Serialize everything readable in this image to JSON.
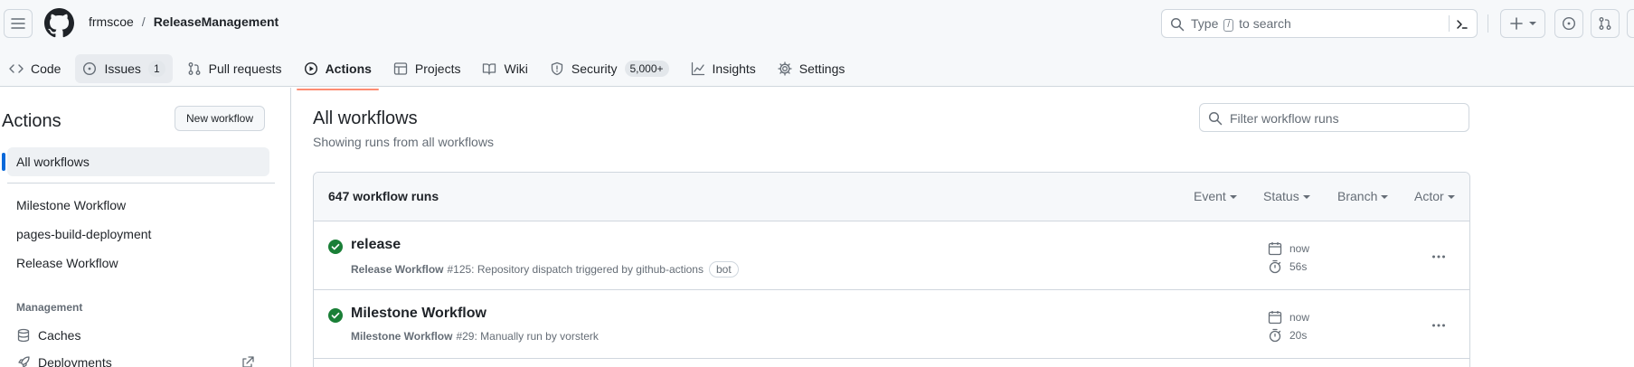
{
  "header": {
    "owner": "frmscoe",
    "separator": "/",
    "repo": "ReleaseManagement",
    "search": {
      "before": "Type",
      "key": "/",
      "after": "to search"
    }
  },
  "tabs": [
    {
      "label": "Code",
      "icon": "code-icon"
    },
    {
      "label": "Issues",
      "icon": "issue-icon",
      "counter": "1"
    },
    {
      "label": "Pull requests",
      "icon": "pull-request-icon"
    },
    {
      "label": "Actions",
      "icon": "play-icon",
      "selected": true
    },
    {
      "label": "Projects",
      "icon": "table-icon"
    },
    {
      "label": "Wiki",
      "icon": "book-icon"
    },
    {
      "label": "Security",
      "icon": "shield-icon",
      "counter": "5,000+"
    },
    {
      "label": "Insights",
      "icon": "graph-icon"
    },
    {
      "label": "Settings",
      "icon": "gear-icon"
    }
  ],
  "sidebar": {
    "title": "Actions",
    "new_workflow": "New workflow",
    "items": [
      {
        "label": "All workflows"
      },
      {
        "label": "Milestone Workflow"
      },
      {
        "label": "pages-build-deployment"
      },
      {
        "label": "Release Workflow"
      }
    ],
    "management_label": "Management",
    "management": [
      {
        "label": "Caches",
        "icon": "database-icon"
      },
      {
        "label": "Deployments",
        "icon": "rocket-icon"
      }
    ]
  },
  "main": {
    "title": "All workflows",
    "subtitle": "Showing runs from all workflows",
    "filter_placeholder": "Filter workflow runs",
    "runs_count": "647 workflow runs",
    "filters": [
      "Event",
      "Status",
      "Branch",
      "Actor"
    ],
    "runs": [
      {
        "title": "release",
        "workflow": "Release Workflow",
        "detail": "#125: Repository dispatch triggered by github-actions",
        "badge": "bot",
        "when": "now",
        "duration": "56s",
        "status": "success"
      },
      {
        "title": "Milestone Workflow",
        "workflow": "Milestone Workflow",
        "detail": "#29: Manually run by vorsterk",
        "badge": "",
        "when": "now",
        "duration": "20s",
        "status": "success"
      }
    ]
  },
  "colors": {
    "accent_underline": "#fd8c73",
    "active_bar": "#0969da",
    "success": "#1a7f37"
  }
}
